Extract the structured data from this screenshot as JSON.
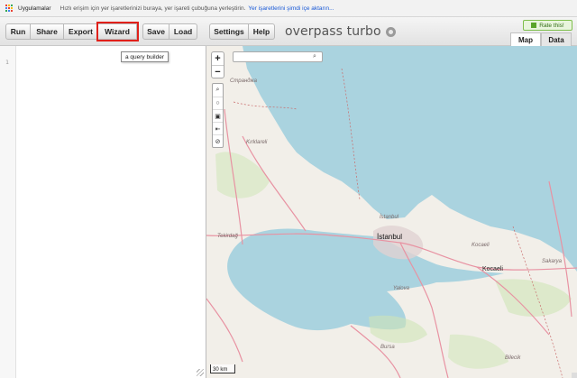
{
  "bookmarks_bar": {
    "apps_label": "Uygulamalar",
    "hint_text": "Hızlı erişim için yer işaretlerinizi buraya, yer işareti çubuğuna yerleştirin.",
    "import_link": "Yer işaretlerini şimdi içe aktarın..."
  },
  "toolbar": {
    "run": "Run",
    "share": "Share",
    "export": "Export",
    "wizard": "Wizard",
    "save": "Save",
    "load": "Load",
    "settings": "Settings",
    "help": "Help",
    "app_title": "overpass turbo",
    "rate": "Rate this!",
    "highlight_color": "#e0201a"
  },
  "tabs": [
    {
      "label": "Map",
      "active": true
    },
    {
      "label": "Data",
      "active": false
    }
  ],
  "editor": {
    "line_numbers": [
      "1"
    ]
  },
  "tooltip": {
    "text": "a query builder"
  },
  "map": {
    "search_placeholder": "",
    "zoom_in": "+",
    "zoom_out": "−",
    "scale_label": "30 km",
    "labels": {
      "strandzha": "Странджа",
      "kirklareli": "Kırklareli",
      "tekirdag": "Tekirdağ",
      "istanbul": "İstanbul",
      "istanbul2": "İstanbul",
      "kocaeli": "Kocaeli",
      "kocaeli_city": "Kocaeli",
      "sakarya": "Sakarya",
      "yalova": "Yalova",
      "bursa": "Bursa",
      "bilecik": "Bilecik"
    },
    "colors": {
      "sea": "#aad3df",
      "land": "#f2efe9",
      "green": "#cfe5b8",
      "road": "#e892a2",
      "urban": "#e0d2d2"
    }
  }
}
